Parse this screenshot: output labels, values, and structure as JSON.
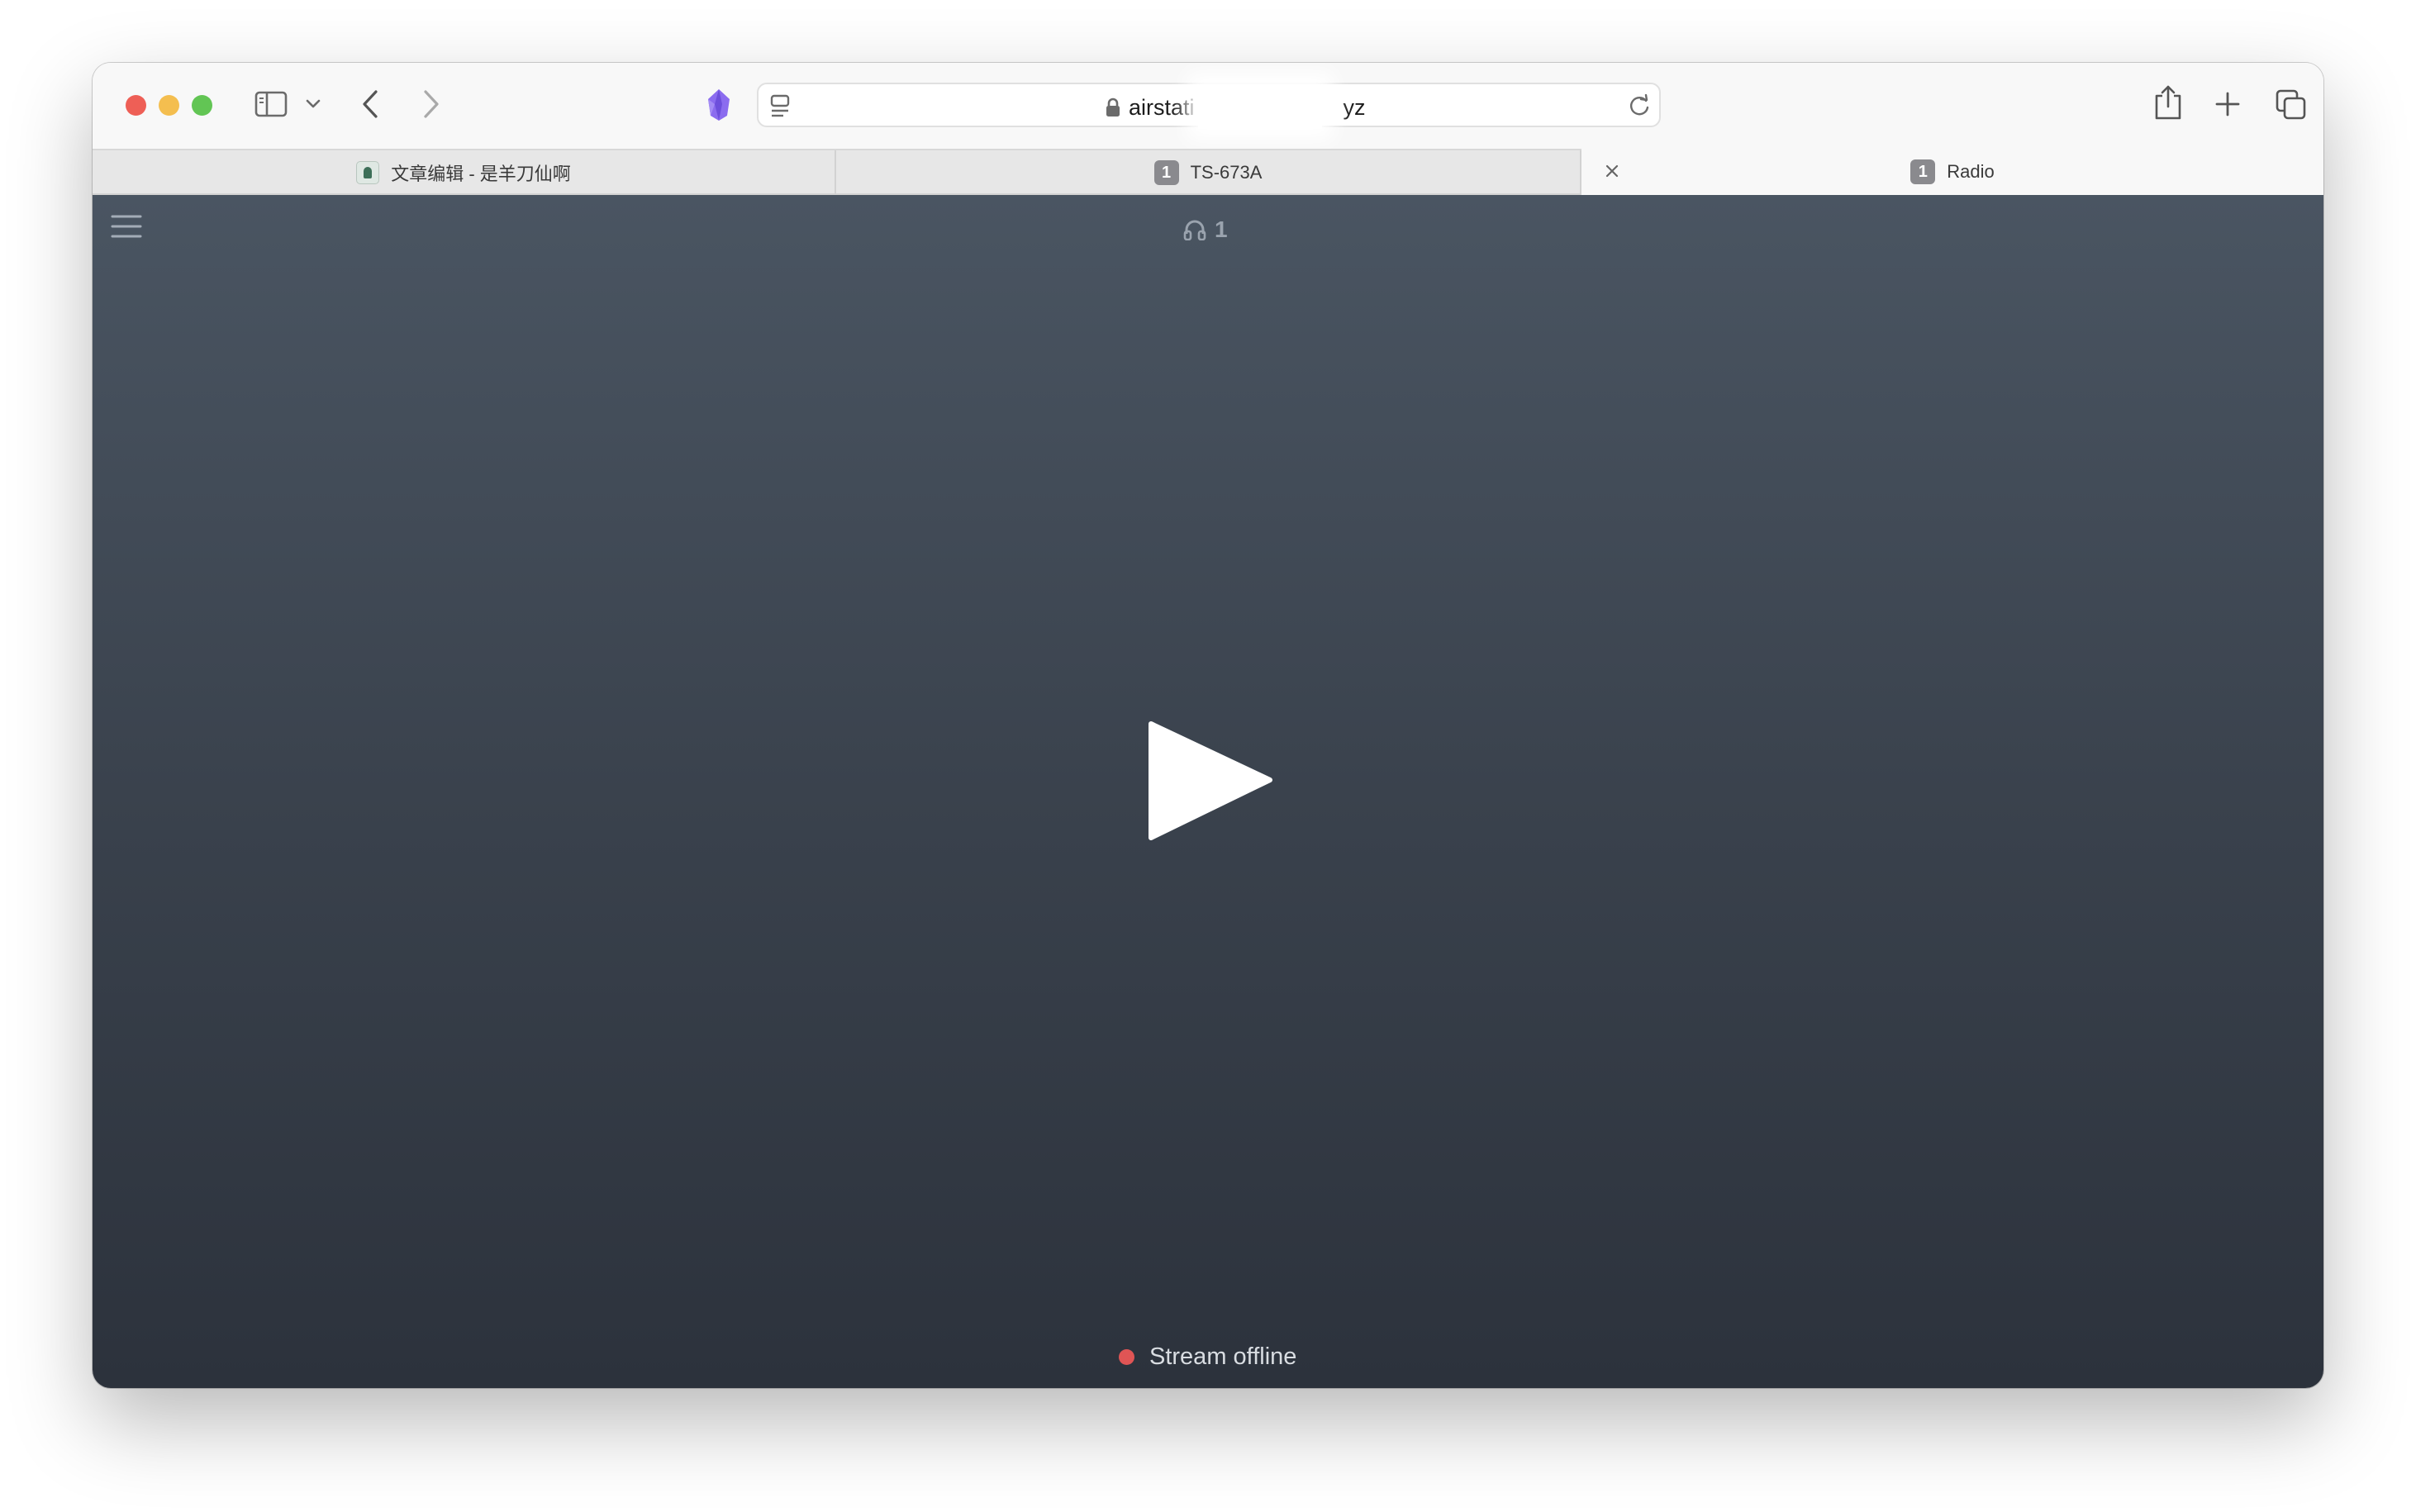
{
  "browser": {
    "address": {
      "url_prefix": "airstati",
      "url_suffix": "yz"
    },
    "tabs": [
      {
        "label": "文章编辑 - 是羊刀仙啊",
        "icon": "site-favicon"
      },
      {
        "label": "TS-673A",
        "badge": "1"
      },
      {
        "label": "Radio",
        "badge": "1",
        "active": true
      }
    ]
  },
  "player": {
    "listeners_count": "1",
    "status_text": "Stream offline",
    "status_color": "#e05555",
    "play_icon": "play-icon",
    "menu_icon": "hamburger-menu-icon"
  }
}
